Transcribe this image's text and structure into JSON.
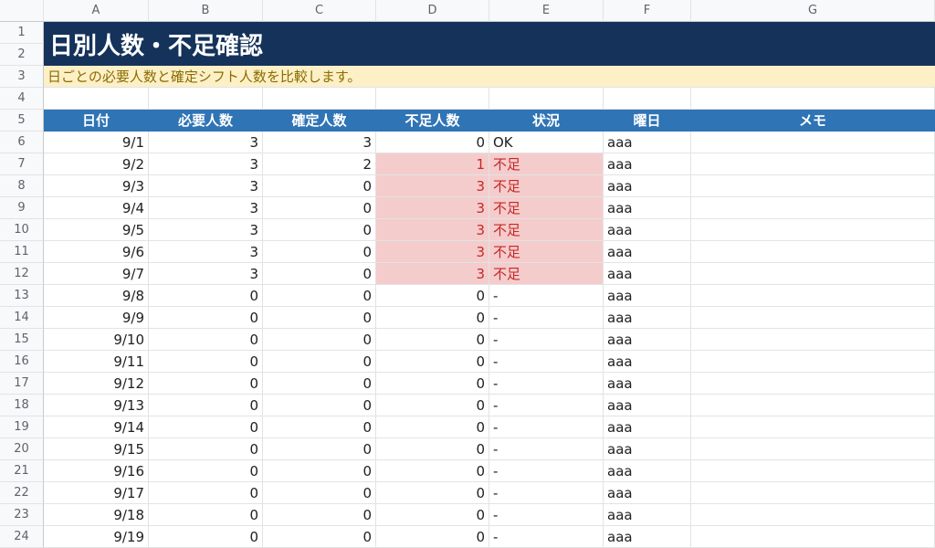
{
  "columns": [
    "A",
    "B",
    "C",
    "D",
    "E",
    "F",
    "G"
  ],
  "title": "日別人数・不足確認",
  "description": "日ごとの必要人数と確定シフト人数を比較します。",
  "headers": [
    "日付",
    "必要人数",
    "確定人数",
    "不足人数",
    "状況",
    "曜日",
    "メモ"
  ],
  "row_numbers": [
    "1",
    "2",
    "3",
    "4",
    "5",
    "6",
    "7",
    "8",
    "9",
    "10",
    "11",
    "12",
    "13",
    "14",
    "15",
    "16",
    "17",
    "18",
    "19",
    "20",
    "21",
    "22",
    "23",
    "24"
  ],
  "rows": [
    {
      "date": "9/1",
      "required": "3",
      "confirmed": "3",
      "shortage": "0",
      "status": "OK",
      "weekday": "aaa",
      "memo": ""
    },
    {
      "date": "9/2",
      "required": "3",
      "confirmed": "2",
      "shortage": "1",
      "status": "不足",
      "weekday": "aaa",
      "memo": ""
    },
    {
      "date": "9/3",
      "required": "3",
      "confirmed": "0",
      "shortage": "3",
      "status": "不足",
      "weekday": "aaa",
      "memo": ""
    },
    {
      "date": "9/4",
      "required": "3",
      "confirmed": "0",
      "shortage": "3",
      "status": "不足",
      "weekday": "aaa",
      "memo": ""
    },
    {
      "date": "9/5",
      "required": "3",
      "confirmed": "0",
      "shortage": "3",
      "status": "不足",
      "weekday": "aaa",
      "memo": ""
    },
    {
      "date": "9/6",
      "required": "3",
      "confirmed": "0",
      "shortage": "3",
      "status": "不足",
      "weekday": "aaa",
      "memo": ""
    },
    {
      "date": "9/7",
      "required": "3",
      "confirmed": "0",
      "shortage": "3",
      "status": "不足",
      "weekday": "aaa",
      "memo": ""
    },
    {
      "date": "9/8",
      "required": "0",
      "confirmed": "0",
      "shortage": "0",
      "status": "-",
      "weekday": "aaa",
      "memo": ""
    },
    {
      "date": "9/9",
      "required": "0",
      "confirmed": "0",
      "shortage": "0",
      "status": "-",
      "weekday": "aaa",
      "memo": ""
    },
    {
      "date": "9/10",
      "required": "0",
      "confirmed": "0",
      "shortage": "0",
      "status": "-",
      "weekday": "aaa",
      "memo": ""
    },
    {
      "date": "9/11",
      "required": "0",
      "confirmed": "0",
      "shortage": "0",
      "status": "-",
      "weekday": "aaa",
      "memo": ""
    },
    {
      "date": "9/12",
      "required": "0",
      "confirmed": "0",
      "shortage": "0",
      "status": "-",
      "weekday": "aaa",
      "memo": ""
    },
    {
      "date": "9/13",
      "required": "0",
      "confirmed": "0",
      "shortage": "0",
      "status": "-",
      "weekday": "aaa",
      "memo": ""
    },
    {
      "date": "9/14",
      "required": "0",
      "confirmed": "0",
      "shortage": "0",
      "status": "-",
      "weekday": "aaa",
      "memo": ""
    },
    {
      "date": "9/15",
      "required": "0",
      "confirmed": "0",
      "shortage": "0",
      "status": "-",
      "weekday": "aaa",
      "memo": ""
    },
    {
      "date": "9/16",
      "required": "0",
      "confirmed": "0",
      "shortage": "0",
      "status": "-",
      "weekday": "aaa",
      "memo": ""
    },
    {
      "date": "9/17",
      "required": "0",
      "confirmed": "0",
      "shortage": "0",
      "status": "-",
      "weekday": "aaa",
      "memo": ""
    },
    {
      "date": "9/18",
      "required": "0",
      "confirmed": "0",
      "shortage": "0",
      "status": "-",
      "weekday": "aaa",
      "memo": ""
    },
    {
      "date": "9/19",
      "required": "0",
      "confirmed": "0",
      "shortage": "0",
      "status": "-",
      "weekday": "aaa",
      "memo": ""
    }
  ],
  "colors": {
    "title_bg": "#14325a",
    "header_bg": "#2f74b5",
    "desc_bg": "#fdf0c7",
    "shortage_bg": "#f4cccc",
    "shortage_text": "#c62828"
  }
}
